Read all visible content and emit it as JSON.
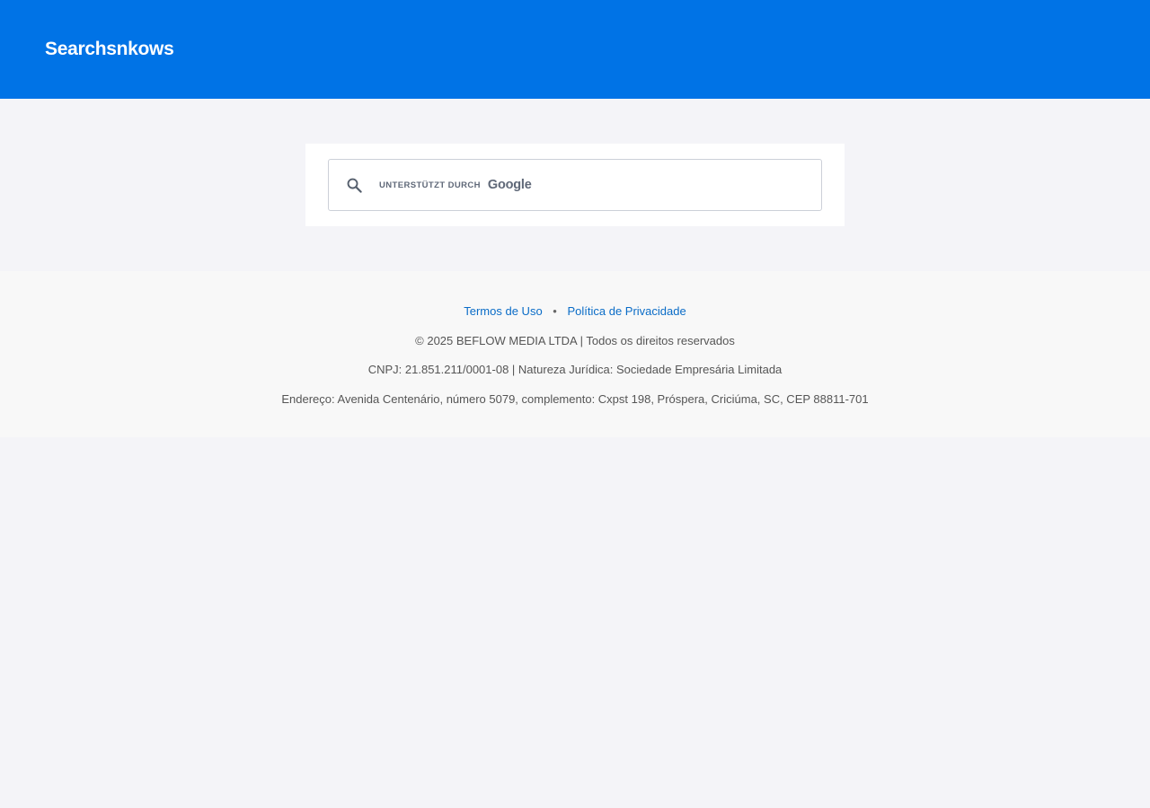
{
  "header": {
    "site_title": "Searchsnkows",
    "background_color": "#0073e6"
  },
  "search": {
    "icon": "search-icon",
    "powered_label": "UNTERSTÜTZT DURCH",
    "brand": "Google",
    "placeholder": "",
    "value": ""
  },
  "footer": {
    "links": [
      {
        "label": "Termos de Uso"
      },
      {
        "label": "Política de Privacidade"
      }
    ],
    "separator": "•",
    "copyright": "© 2025 BEFLOW MEDIA LTDA | Todos os direitos reservados",
    "cnpj": "CNPJ: 21.851.211/0001-08 | Natureza Jurídica: Sociedade Empresária Limitada",
    "address": "Endereço: Avenida Centenário, número 5079, complemento: Cxpst 198, Próspera, Criciúma, SC, CEP 88811-701",
    "link_color": "#0a6cc7"
  }
}
